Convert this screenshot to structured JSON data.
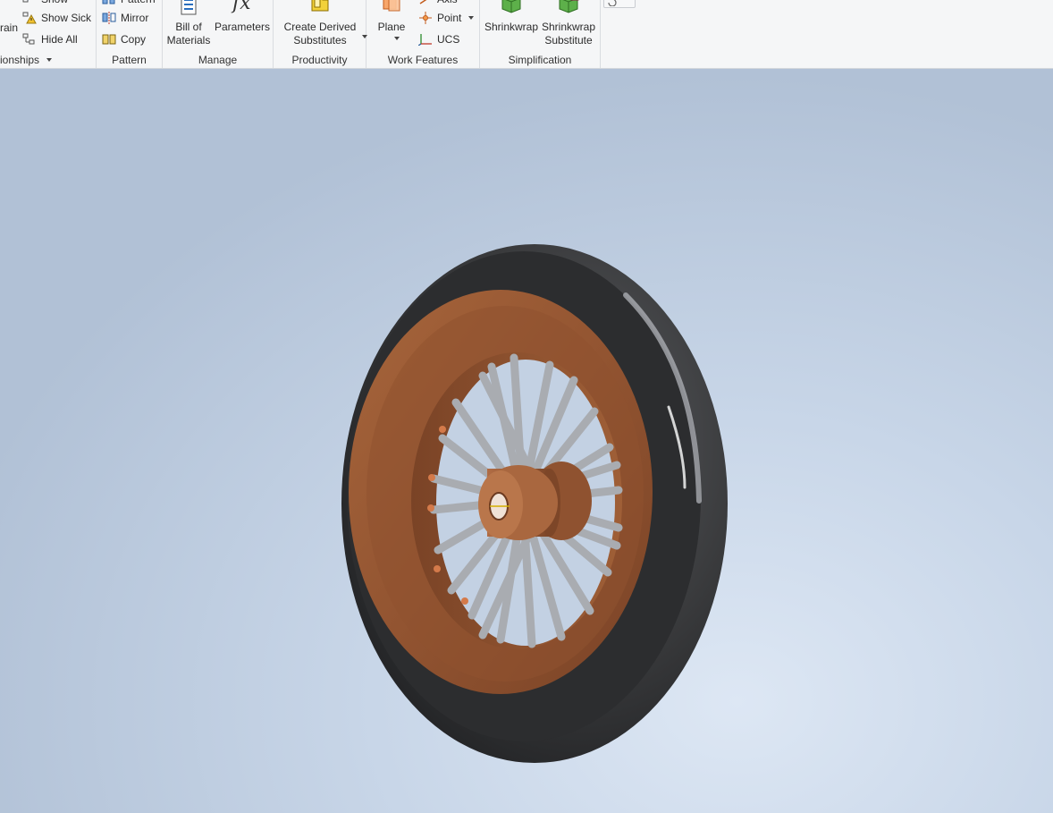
{
  "ribbon": {
    "relationships": {
      "constrain_label": "rain",
      "show_label": "Show",
      "show_sick_label": "Show Sick",
      "hide_all_label": "Hide All",
      "panel_title": "ionships"
    },
    "pattern": {
      "pattern_label": "Pattern",
      "mirror_label": "Mirror",
      "copy_label": "Copy",
      "panel_title": "Pattern"
    },
    "manage": {
      "bom_line1": "Bill of",
      "bom_line2": "Materials",
      "parameters_label": "Parameters",
      "panel_title": "Manage"
    },
    "productivity": {
      "derived_line1": "Create Derived",
      "derived_line2": "Substitutes",
      "panel_title": "Productivity"
    },
    "work_features": {
      "plane_label": "Plane",
      "axis_label": "Axis",
      "point_label": "Point",
      "ucs_label": "UCS",
      "panel_title": "Work Features"
    },
    "simplification": {
      "shrinkwrap_label": "Shrinkwrap",
      "shrinkwrap_sub_line1": "Shrinkwrap",
      "shrinkwrap_sub_line2": "Substitute",
      "panel_title": "Simplification"
    }
  },
  "icons": {
    "show": "show-icon",
    "show_sick": "show-sick-icon",
    "hide_all": "hide-all-icon",
    "mirror": "mirror-icon",
    "copy": "copy-icon",
    "bom": "bill-of-materials-icon",
    "parameters": "parameters-fx-icon",
    "derived": "create-derived-substitutes-icon",
    "plane": "plane-icon",
    "axis": "axis-icon",
    "point": "point-icon",
    "ucs": "ucs-icon",
    "shrinkwrap": "shrinkwrap-icon",
    "shrinkwrap_substitute": "shrinkwrap-substitute-icon"
  },
  "colors": {
    "tire": "#3a3b3d",
    "rim": "#9a5a34",
    "spokes": "#a9acb1",
    "hub": "#a0603a",
    "viewport_bg": "#c8d6e8"
  }
}
